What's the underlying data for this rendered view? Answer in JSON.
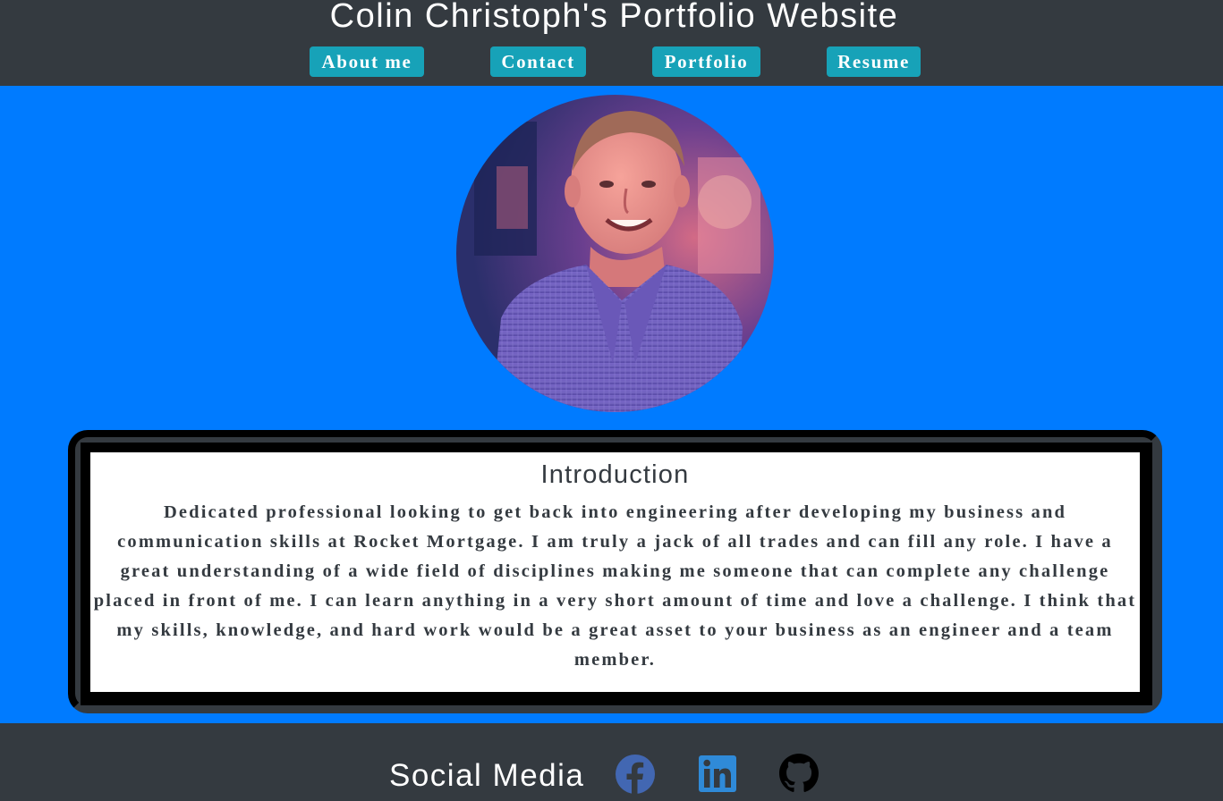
{
  "header": {
    "title": "Colin Christoph's Portfolio Website",
    "nav": [
      {
        "label": "About me"
      },
      {
        "label": "Contact"
      },
      {
        "label": "Portfolio"
      },
      {
        "label": "Resume"
      }
    ]
  },
  "main": {
    "avatar_icon": "profile-photo",
    "intro": {
      "title": "Introduction",
      "text": "Dedicated professional looking to get back into engineering after developing my business and communication skills at Rocket Mortgage. I am truly a jack of all trades and can fill any role. I have a great understanding of a wide field of disciplines making me someone that can complete any challenge placed in front of me. I can learn anything in a very short amount of time and love a challenge. I think that my skills, knowledge, and hard work would be a great asset to your business as an engineer and a team member."
    }
  },
  "footer": {
    "title": "Social Media",
    "icons": [
      "facebook-icon",
      "linkedin-icon",
      "github-icon"
    ]
  },
  "colors": {
    "header_bg": "#343a40",
    "main_bg": "#007bff",
    "button_bg": "#17a2b8",
    "text_dark": "#343a40",
    "facebook": "#4267b2",
    "linkedin": "#2f8ad8"
  }
}
